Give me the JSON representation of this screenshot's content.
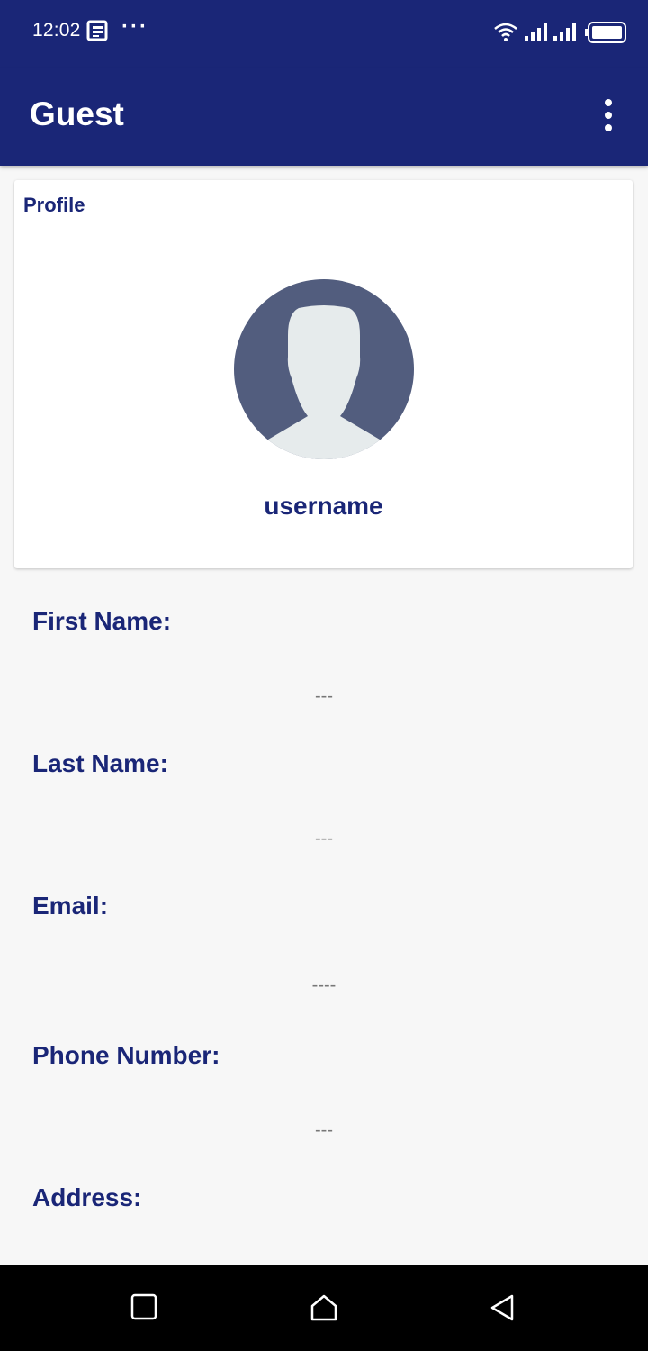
{
  "status_bar": {
    "time": "12:02",
    "dots": "···",
    "icons": [
      "news-icon",
      "wifi-icon",
      "signal-icon",
      "signal-icon",
      "battery-icon"
    ]
  },
  "app_bar": {
    "title": "Guest",
    "menu_icon": "more-vert-icon"
  },
  "profile_card": {
    "title": "Profile",
    "avatar_icon": "person-avatar-icon",
    "username": "username"
  },
  "fields": [
    {
      "label": "First Name:",
      "value": "---"
    },
    {
      "label": "Last Name:",
      "value": "---"
    },
    {
      "label": "Email:",
      "value": "----"
    },
    {
      "label": "Phone Number:",
      "value": "---"
    },
    {
      "label": "Address:",
      "value": ""
    }
  ],
  "nav_bar": {
    "icons": [
      "recents-square-icon",
      "home-icon",
      "back-triangle-icon"
    ]
  },
  "colors": {
    "primary": "#1a2677",
    "avatar_bg": "#525d7e",
    "avatar_fg": "#e6ebec",
    "background": "#f7f7f7"
  }
}
